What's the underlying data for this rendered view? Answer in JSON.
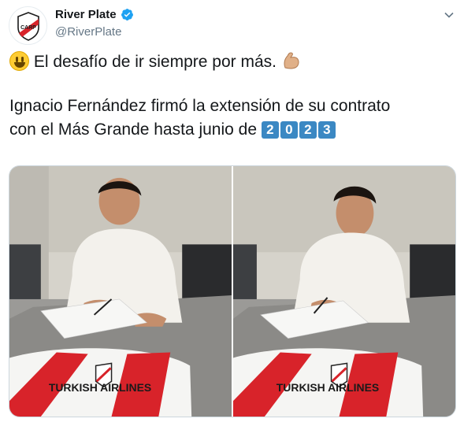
{
  "tweet": {
    "author": {
      "display_name": "River Plate",
      "handle": "@RiverPlate",
      "verified": true,
      "avatar_icon": "river-plate-crest-icon"
    },
    "menu_icon": "chevron-down-icon",
    "lines": [
      {
        "emoji_before": "smiling-face-icon",
        "text": "El desafío de ir siempre por más.",
        "emoji_after": "flexed-biceps-icon"
      },
      {
        "text": "Ignacio Fernández firmó la extensión de su contrato"
      },
      {
        "text": "con el Más Grande hasta junio de",
        "keycaps": [
          "2",
          "0",
          "2",
          "3"
        ]
      }
    ],
    "media": [
      {
        "name": "photo-signing-smiling",
        "shirt_text": "TURKISH AIRLINES"
      },
      {
        "name": "photo-signing-head-down",
        "shirt_text": "TURKISH AIRLINES"
      }
    ],
    "colors": {
      "verified": "#1da1f2",
      "keycap": "#3b88c3",
      "river_red": "#d8232a",
      "handle": "#657786"
    }
  }
}
